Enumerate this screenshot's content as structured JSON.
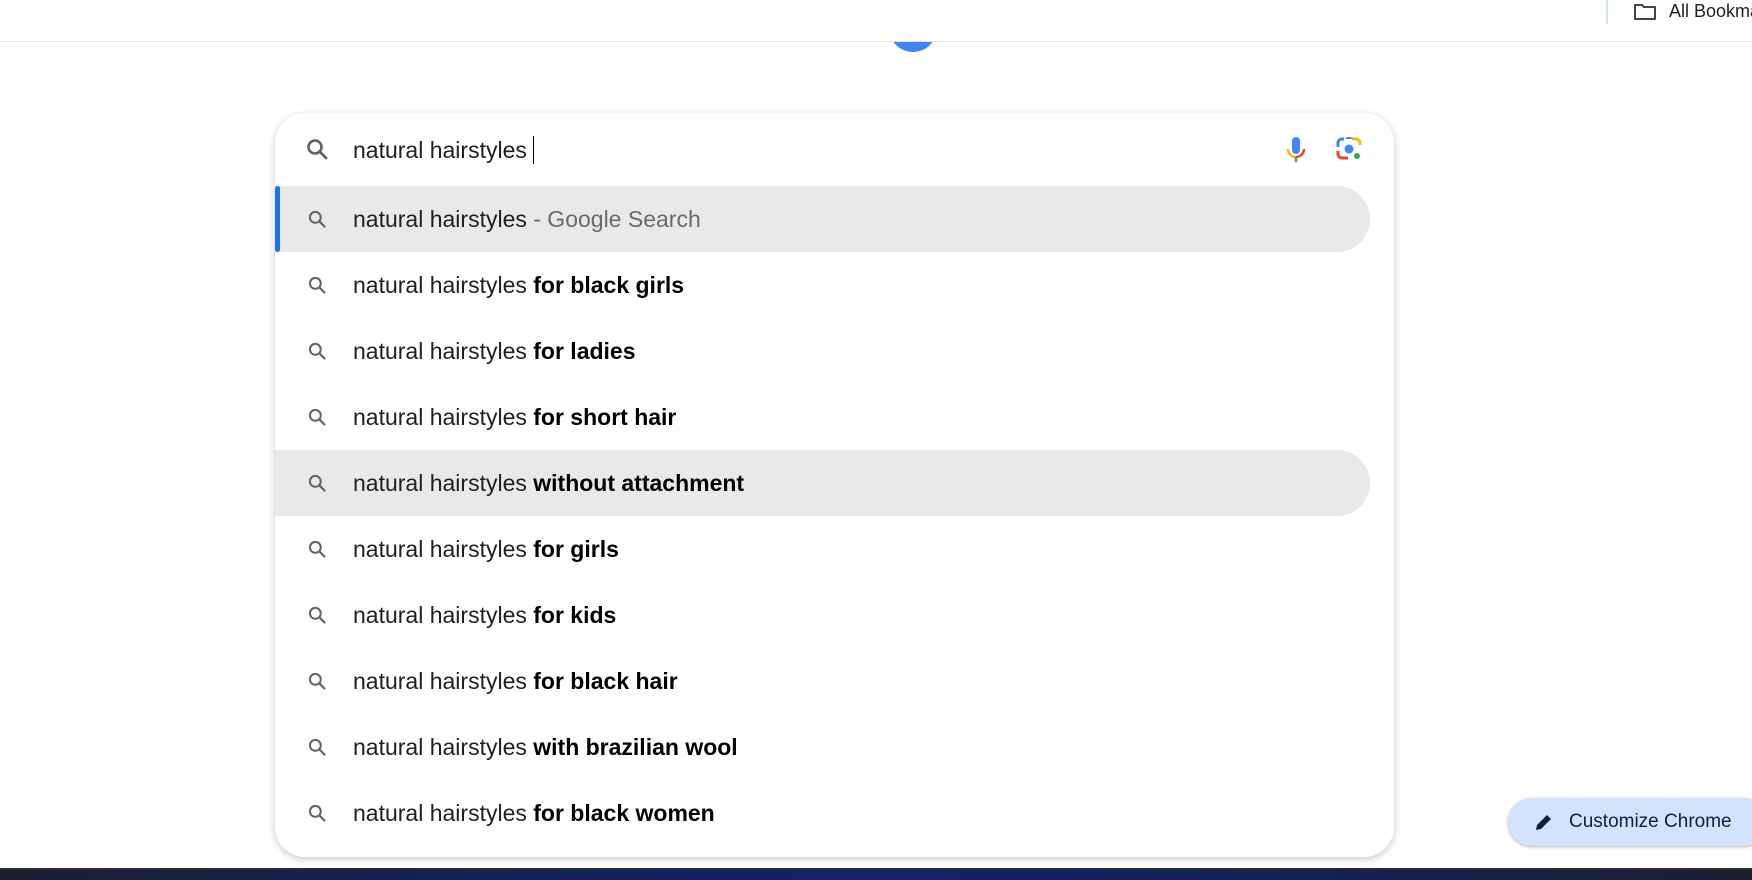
{
  "bookmarks_bar": {
    "all_bookmarks_label": "All Bookmarks",
    "icon": "folder-icon"
  },
  "search": {
    "query": "natural hairstyles",
    "suggestions": [
      {
        "prefix": "natural hairstyles",
        "bold": "",
        "suffix": " - Google Search",
        "highlighted": true,
        "selected": true
      },
      {
        "prefix": "natural hairstyles ",
        "bold": "for black girls",
        "suffix": ""
      },
      {
        "prefix": "natural hairstyles ",
        "bold": "for ladies",
        "suffix": ""
      },
      {
        "prefix": "natural hairstyles ",
        "bold": "for short hair",
        "suffix": ""
      },
      {
        "prefix": "natural hairstyles ",
        "bold": "without attachment",
        "suffix": "",
        "highlighted": true
      },
      {
        "prefix": "natural hairstyles ",
        "bold": "for girls",
        "suffix": ""
      },
      {
        "prefix": "natural hairstyles ",
        "bold": "for kids",
        "suffix": ""
      },
      {
        "prefix": "natural hairstyles ",
        "bold": "for black hair",
        "suffix": ""
      },
      {
        "prefix": "natural hairstyles ",
        "bold": "with brazilian wool",
        "suffix": ""
      },
      {
        "prefix": "natural hairstyles ",
        "bold": "for black women",
        "suffix": ""
      }
    ]
  },
  "customize_chrome": {
    "label": "Customize Chrome",
    "icon": "pencil-icon"
  },
  "colors": {
    "accent": "#1a73e8",
    "highlight": "#e9e9e9",
    "customize_bg": "#d3e3fd"
  }
}
